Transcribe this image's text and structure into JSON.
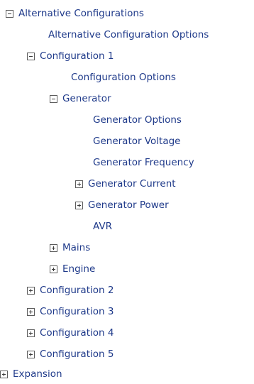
{
  "tree": {
    "nodes": [
      {
        "label": "Alternative Configurations",
        "expander": "collapse",
        "level": 0
      },
      {
        "label": "Alternative Configuration Options",
        "expander": null,
        "level": 1
      },
      {
        "label": "Configuration 1",
        "expander": "collapse",
        "level": 1
      },
      {
        "label": "Configuration Options",
        "expander": null,
        "level": 2
      },
      {
        "label": "Generator",
        "expander": "collapse",
        "level": 2
      },
      {
        "label": "Generator Options",
        "expander": null,
        "level": 3
      },
      {
        "label": "Generator Voltage",
        "expander": null,
        "level": 3
      },
      {
        "label": "Generator Frequency",
        "expander": null,
        "level": 3
      },
      {
        "label": "Generator Current",
        "expander": "expand",
        "level": 3
      },
      {
        "label": "Generator Power",
        "expander": "expand",
        "level": 3
      },
      {
        "label": "AVR",
        "expander": null,
        "level": 3
      },
      {
        "label": "Mains",
        "expander": "expand",
        "level": 2
      },
      {
        "label": "Engine",
        "expander": "expand",
        "level": 2
      },
      {
        "label": "Configuration 2",
        "expander": "expand",
        "level": 1
      },
      {
        "label": "Configuration 3",
        "expander": "expand",
        "level": 1
      },
      {
        "label": "Configuration 4",
        "expander": "expand",
        "level": 1
      },
      {
        "label": "Configuration 5",
        "expander": "expand",
        "level": 1
      },
      {
        "label": "Expansion",
        "expander": "expand",
        "level": 0
      }
    ]
  },
  "colors": {
    "label_text": "#1f3a8a",
    "expander_border": "#5c5c5c",
    "background": "#ffffff"
  }
}
